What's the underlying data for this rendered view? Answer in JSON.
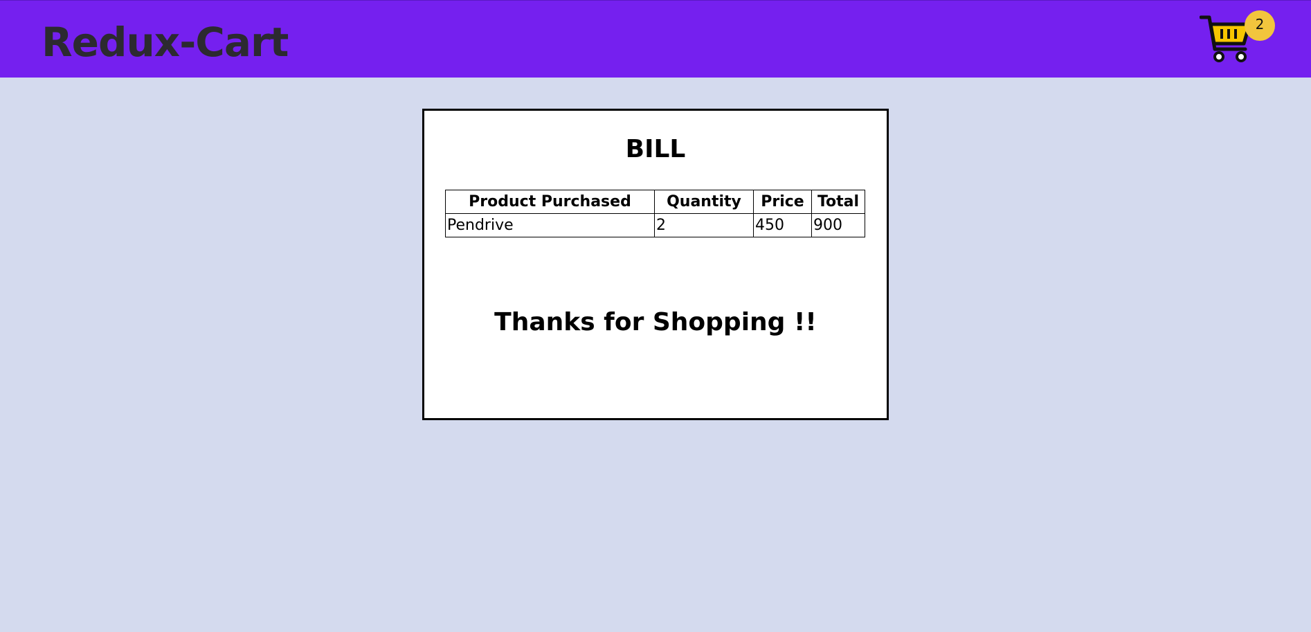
{
  "header": {
    "brand": "Redux-Cart",
    "cart_count": "2",
    "cart_icon": "shopping-cart-icon",
    "colors": {
      "navbar": "#7520ef",
      "badge": "#f2c53d",
      "background": "#d4daee"
    }
  },
  "bill": {
    "title": "BILL",
    "columns": [
      "Product Purchased",
      "Quantity",
      "Price",
      "Total"
    ],
    "rows": [
      [
        "Pendrive",
        "2",
        "450",
        "900"
      ]
    ],
    "thanks": "Thanks for Shopping !!"
  }
}
